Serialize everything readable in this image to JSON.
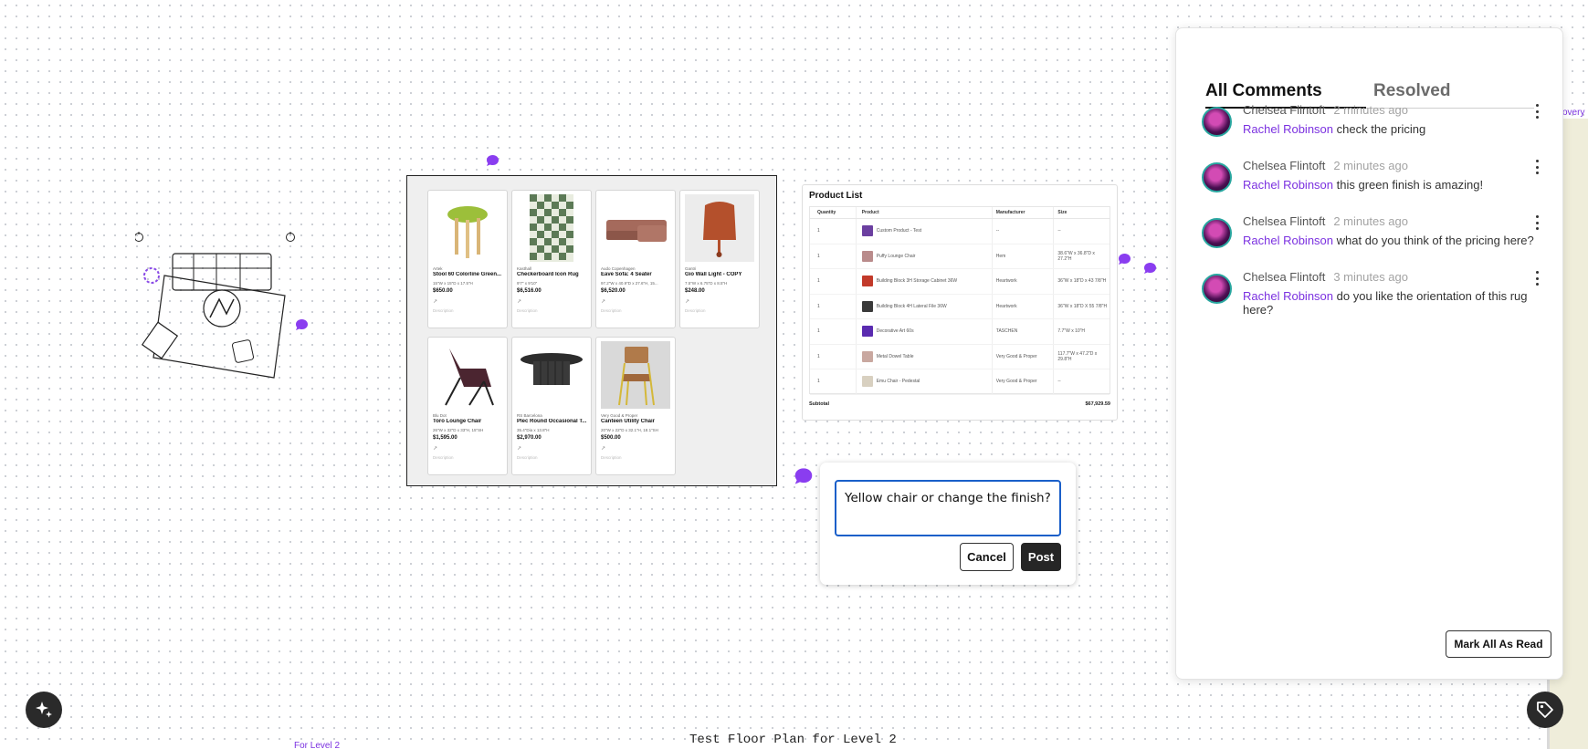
{
  "moodboard": {
    "products": [
      {
        "brand": "Artek",
        "name": "Stool 60 Colorline Green...",
        "dims": "15\"W x 15\"D x 17.5\"H",
        "price": "$650.00",
        "desc": "Description"
      },
      {
        "brand": "Kasthall",
        "name": "Checkerboard Icon Rug",
        "dims": "9'7\" x 9'10\"",
        "price": "$6,516.00",
        "desc": "Description"
      },
      {
        "brand": "Audo Copenhagen",
        "name": "Eave Sofa: 4 Seater",
        "dims": "97.2\"W x 40.9\"D x 27.6\"H, 15...",
        "price": "$6,520.00",
        "desc": "Description"
      },
      {
        "brand": "Gantri",
        "name": "Gio Wall Light - COPY",
        "dims": "7.5\"W x 6.75\"D x 8.5\"H",
        "price": "$248.00",
        "desc": "Description"
      },
      {
        "brand": "Blu Dot",
        "name": "Toro Lounge Chair",
        "dims": "26\"W x 32\"D x 33\"H, 15\"SH",
        "price": "$1,595.00",
        "desc": "Description"
      },
      {
        "brand": "RS Barcelona",
        "name": "Plec Round Occasional T...",
        "dims": "35.4\"Dia x 13.8\"H",
        "price": "$2,970.00",
        "desc": "Description"
      },
      {
        "brand": "Very Good & Proper",
        "name": "Canteen Utility Chair",
        "dims": "20\"W x 22\"D x 32.1\"H, 18.1\"SH",
        "price": "$500.00",
        "desc": "Description"
      }
    ]
  },
  "product_list": {
    "title": "Product List",
    "headers": {
      "quantity": "Quantity",
      "product": "Product",
      "manufacturer": "Manufacturer",
      "size": "Size"
    },
    "rows": [
      {
        "qty": "1",
        "product": "Custom Product - Test",
        "manufacturer": "--",
        "size": "--",
        "thumb": "#6b3fa0"
      },
      {
        "qty": "1",
        "product": "Puffy Lounge Chair",
        "manufacturer": "Hem",
        "size": "38.6\"W x 36.8\"D x 27.2\"H",
        "thumb": "#b98b8b"
      },
      {
        "qty": "1",
        "product": "Building Block 3H Storage Cabinet 36W",
        "manufacturer": "Heartwork",
        "size": "36\"W x 18\"D x 43 7/8\"H",
        "thumb": "#c23a2a"
      },
      {
        "qty": "1",
        "product": "Building Block 4H Lateral File 36W",
        "manufacturer": "Heartwork",
        "size": "36\"W x 18\"D X 55 7/8\"H",
        "thumb": "#3a3a3a"
      },
      {
        "qty": "1",
        "product": "Decorative Art 60s",
        "manufacturer": "TASCHEN",
        "size": "7.7\"W x 10\"H",
        "thumb": "#5a2bb0"
      },
      {
        "qty": "1",
        "product": "Metal Dowel Table",
        "manufacturer": "Very Good & Proper",
        "size": "117.7\"W x 47.2\"D x 29.8\"H",
        "thumb": "#c9a8a0"
      },
      {
        "qty": "1",
        "product": "Emu Chair - Pedestal",
        "manufacturer": "Very Good & Proper",
        "size": "--",
        "thumb": "#d8d0c0"
      }
    ],
    "subtotal_label": "Subtotal",
    "subtotal_value": "$67,929.59"
  },
  "composer": {
    "value": "Yellow chair or change the finish?",
    "cancel_label": "Cancel",
    "post_label": "Post"
  },
  "comments_panel": {
    "tab_all": "All Comments",
    "tab_resolved": "Resolved",
    "comments": [
      {
        "author": "Chelsea Flintoft",
        "time": "2 minutes ago",
        "mention": "Rachel Robinson",
        "text": "check the pricing"
      },
      {
        "author": "Chelsea Flintoft",
        "time": "2 minutes ago",
        "mention": "Rachel Robinson",
        "text": "this green finish is amazing!"
      },
      {
        "author": "Chelsea Flintoft",
        "time": "2 minutes ago",
        "mention": "Rachel Robinson",
        "text": "what do you think of the pricing here?"
      },
      {
        "author": "Chelsea Flintoft",
        "time": "3 minutes ago",
        "mention": "Rachel Robinson",
        "text": "do you like the orientation of this rug here?"
      }
    ],
    "mark_all_label": "Mark All As Read"
  },
  "canvas": {
    "floor_title": "Test Floor Plan for Level 2",
    "floor_link": "For Level 2",
    "side_label": "covery"
  },
  "colors": {
    "accent": "#7b31e0",
    "input_focus": "#1a5fc9",
    "dark": "#262626"
  },
  "icons": [
    "comment-pin-icon",
    "sparkle-icon",
    "tag-icon",
    "kebab-menu-icon",
    "external-link-icon"
  ]
}
